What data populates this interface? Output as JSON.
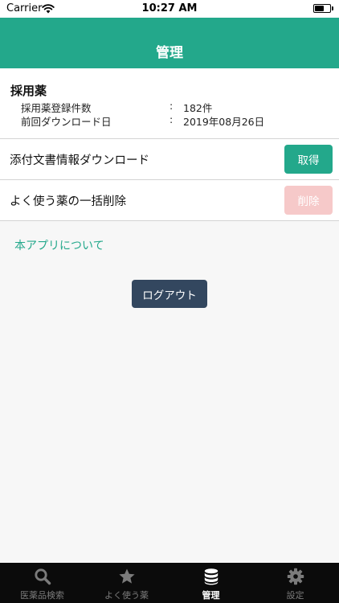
{
  "status_bar": {
    "carrier": "Carrier",
    "time": "10:27 AM",
    "battery_level": 0.6
  },
  "header": {
    "title": "管理"
  },
  "adopted_drugs": {
    "title": "採用薬",
    "rows": [
      {
        "label": "採用薬登録件数",
        "colon": ":",
        "value": "182件"
      },
      {
        "label": "前回ダウンロード日",
        "colon": ":",
        "value": "2019年08月26日"
      }
    ]
  },
  "actions": {
    "download": {
      "label": "添付文書情報ダウンロード",
      "button": "取得"
    },
    "bulk_delete": {
      "label": "よく使う薬の一括削除",
      "button": "削除"
    }
  },
  "about_link": "本アプリについて",
  "logout": "ログアウト",
  "tabs": [
    {
      "label": "医薬品検索",
      "icon": "search-icon",
      "active": false
    },
    {
      "label": "よく使う薬",
      "icon": "star-icon",
      "active": false
    },
    {
      "label": "管理",
      "icon": "database-icon",
      "active": true
    },
    {
      "label": "設定",
      "icon": "gear-icon",
      "active": false
    }
  ],
  "colors": {
    "accent": "#23a88b",
    "disabled_button": "#f6c9c9",
    "logout_button": "#33475f",
    "tab_bar": "#0b0b0b"
  }
}
